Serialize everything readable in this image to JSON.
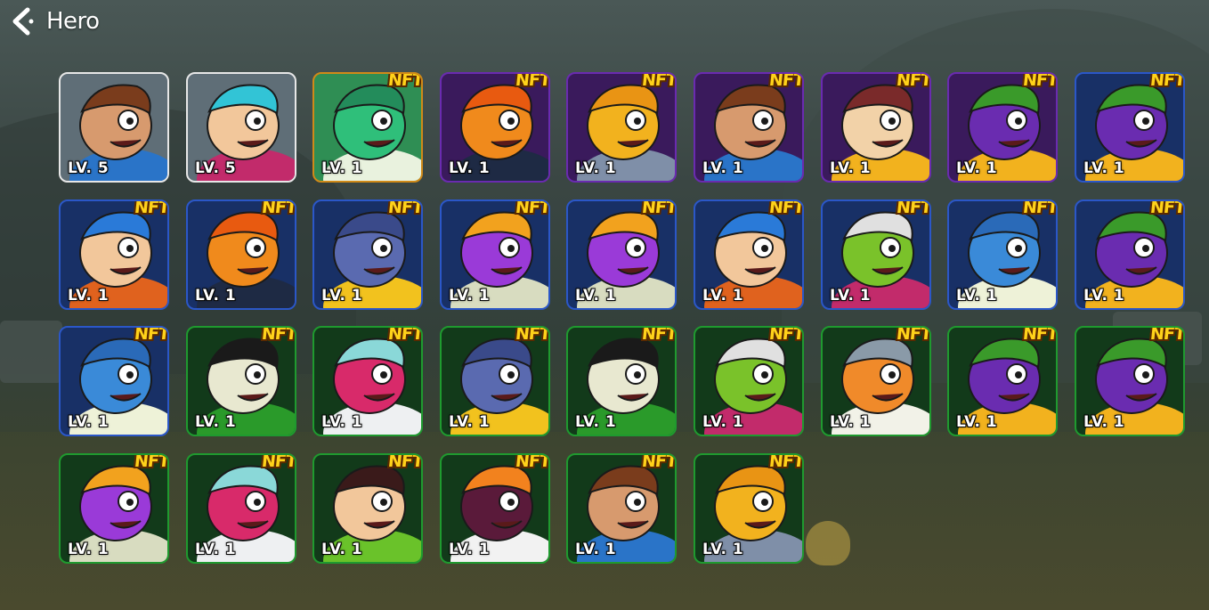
{
  "header": {
    "title": "Hero",
    "back_icon": "chevron-left-icon"
  },
  "heroes": [
    {
      "level_label": "LV. 5",
      "nft": false,
      "rarity": "white",
      "character": "caveman-blue",
      "skin": "#d79a6e",
      "accent": "#2a74c8",
      "hair": "#7a3c1c"
    },
    {
      "level_label": "LV. 5",
      "nft": false,
      "rarity": "white",
      "character": "flower-girl",
      "skin": "#f2c79b",
      "accent": "#c22b6b",
      "hair": "#32c4d6"
    },
    {
      "level_label": "LV. 1",
      "nft": true,
      "nft_label": "NFT",
      "rarity": "gold",
      "character": "green-dino",
      "skin": "#2fbf7a",
      "accent": "#e9f2de",
      "hair": "#238c5b"
    },
    {
      "level_label": "LV. 1",
      "nft": true,
      "nft_label": "NFT",
      "rarity": "purple",
      "character": "orange-bird",
      "skin": "#f08a1c",
      "accent": "#1e2a44",
      "hair": "#e85a10"
    },
    {
      "level_label": "LV. 1",
      "nft": true,
      "nft_label": "NFT",
      "rarity": "purple",
      "character": "yellow-duck",
      "skin": "#f2b21e",
      "accent": "#7f8fa8",
      "hair": "#e99414"
    },
    {
      "level_label": "LV. 1",
      "nft": true,
      "nft_label": "NFT",
      "rarity": "purple",
      "character": "caveman-blue",
      "skin": "#d79a6e",
      "accent": "#2a74c8",
      "hair": "#7a3c1c"
    },
    {
      "level_label": "LV. 1",
      "nft": true,
      "nft_label": "NFT",
      "rarity": "purple",
      "character": "monkey",
      "skin": "#f2d2a8",
      "accent": "#f2b21e",
      "hair": "#7a2a2a"
    },
    {
      "level_label": "LV. 1",
      "nft": true,
      "nft_label": "NFT",
      "rarity": "purple",
      "character": "purple-dragon",
      "skin": "#6a2cb0",
      "accent": "#f2b21e",
      "hair": "#3a9a2a"
    },
    {
      "level_label": "LV. 1",
      "nft": true,
      "nft_label": "NFT",
      "rarity": "blue",
      "character": "purple-dragon",
      "skin": "#6a2cb0",
      "accent": "#f2b21e",
      "hair": "#3a9a2a"
    },
    {
      "level_label": "LV. 1",
      "nft": true,
      "nft_label": "NFT",
      "rarity": "blue",
      "character": "blue-hair-warrior",
      "skin": "#f2c79b",
      "accent": "#e0621e",
      "hair": "#2a7ad8"
    },
    {
      "level_label": "LV. 1",
      "nft": true,
      "nft_label": "NFT",
      "rarity": "blue",
      "character": "orange-bird",
      "skin": "#f08a1c",
      "accent": "#1e2a44",
      "hair": "#e85a10"
    },
    {
      "level_label": "LV. 1",
      "nft": true,
      "nft_label": "NFT",
      "rarity": "blue",
      "character": "blue-shark-yellow",
      "skin": "#5a6ab0",
      "accent": "#f2c21e",
      "hair": "#3a4a8a"
    },
    {
      "level_label": "LV. 1",
      "nft": true,
      "nft_label": "NFT",
      "rarity": "blue",
      "character": "purple-rhino",
      "skin": "#9a3ad8",
      "accent": "#d8dcc0",
      "hair": "#f2a21e"
    },
    {
      "level_label": "LV. 1",
      "nft": true,
      "nft_label": "NFT",
      "rarity": "blue",
      "character": "purple-rhino",
      "skin": "#9a3ad8",
      "accent": "#d8dcc0",
      "hair": "#f2a21e"
    },
    {
      "level_label": "LV. 1",
      "nft": true,
      "nft_label": "NFT",
      "rarity": "blue",
      "character": "blue-hair-warrior",
      "skin": "#f2c79b",
      "accent": "#e0621e",
      "hair": "#2a7ad8"
    },
    {
      "level_label": "LV. 1",
      "nft": true,
      "nft_label": "NFT",
      "rarity": "blue",
      "character": "green-ogre",
      "skin": "#7ac22a",
      "accent": "#c22b6b",
      "hair": "#e0e0e0"
    },
    {
      "level_label": "LV. 1",
      "nft": true,
      "nft_label": "NFT",
      "rarity": "blue",
      "character": "blue-shark",
      "skin": "#3a8ad8",
      "accent": "#eef2d8",
      "hair": "#2a6ab8"
    },
    {
      "level_label": "LV. 1",
      "nft": true,
      "nft_label": "NFT",
      "rarity": "blue",
      "character": "purple-dragon",
      "skin": "#6a2cb0",
      "accent": "#f2b21e",
      "hair": "#3a9a2a"
    },
    {
      "level_label": "LV. 1",
      "nft": true,
      "nft_label": "NFT",
      "rarity": "blue",
      "character": "blue-shark",
      "skin": "#3a8ad8",
      "accent": "#eef2d8",
      "hair": "#2a6ab8"
    },
    {
      "level_label": "LV. 1",
      "nft": true,
      "nft_label": "NFT",
      "rarity": "green",
      "character": "white-cat-shades",
      "skin": "#e8e8d0",
      "accent": "#2a9a2a",
      "hair": "#1a1a1a"
    },
    {
      "level_label": "LV. 1",
      "nft": true,
      "nft_label": "NFT",
      "rarity": "green",
      "character": "pink-beast",
      "skin": "#d82a6a",
      "accent": "#eef0f2",
      "hair": "#8ad8d8"
    },
    {
      "level_label": "LV. 1",
      "nft": true,
      "nft_label": "NFT",
      "rarity": "green",
      "character": "blue-shark-yellow",
      "skin": "#5a6ab0",
      "accent": "#f2c21e",
      "hair": "#3a4a8a"
    },
    {
      "level_label": "LV. 1",
      "nft": true,
      "nft_label": "NFT",
      "rarity": "green",
      "character": "white-cat-shades",
      "skin": "#e8e8d0",
      "accent": "#2a9a2a",
      "hair": "#1a1a1a"
    },
    {
      "level_label": "LV. 1",
      "nft": true,
      "nft_label": "NFT",
      "rarity": "green",
      "character": "green-ogre",
      "skin": "#7ac22a",
      "accent": "#c22b6b",
      "hair": "#e0e0e0"
    },
    {
      "level_label": "LV. 1",
      "nft": true,
      "nft_label": "NFT",
      "rarity": "green",
      "character": "old-sage",
      "skin": "#f08a2a",
      "accent": "#f2f2e8",
      "hair": "#8a9aa8"
    },
    {
      "level_label": "LV. 1",
      "nft": true,
      "nft_label": "NFT",
      "rarity": "green",
      "character": "purple-dragon",
      "skin": "#6a2cb0",
      "accent": "#f2b21e",
      "hair": "#3a9a2a"
    },
    {
      "level_label": "LV. 1",
      "nft": true,
      "nft_label": "NFT",
      "rarity": "green",
      "character": "purple-dragon",
      "skin": "#6a2cb0",
      "accent": "#f2b21e",
      "hair": "#3a9a2a"
    },
    {
      "level_label": "LV. 1",
      "nft": true,
      "nft_label": "NFT",
      "rarity": "green",
      "character": "purple-rhino",
      "skin": "#9a3ad8",
      "accent": "#d8dcc0",
      "hair": "#f2a21e"
    },
    {
      "level_label": "LV. 1",
      "nft": true,
      "nft_label": "NFT",
      "rarity": "green",
      "character": "pink-beast",
      "skin": "#d82a6a",
      "accent": "#eef0f2",
      "hair": "#8ad8d8"
    },
    {
      "level_label": "LV. 1",
      "nft": true,
      "nft_label": "NFT",
      "rarity": "green",
      "character": "leaf-caveman",
      "skin": "#f2c79b",
      "accent": "#6ac22a",
      "hair": "#3a1a1a"
    },
    {
      "level_label": "LV. 1",
      "nft": true,
      "nft_label": "NFT",
      "rarity": "green",
      "character": "grin-monster",
      "skin": "#5a1a3a",
      "accent": "#f2f2f2",
      "hair": "#f2821e"
    },
    {
      "level_label": "LV. 1",
      "nft": true,
      "nft_label": "NFT",
      "rarity": "green",
      "character": "caveman-blue",
      "skin": "#d79a6e",
      "accent": "#2a74c8",
      "hair": "#7a3c1c"
    },
    {
      "level_label": "LV. 1",
      "nft": true,
      "nft_label": "NFT",
      "rarity": "green",
      "character": "yellow-duck",
      "skin": "#f2b21e",
      "accent": "#7f8fa8",
      "hair": "#e99414"
    }
  ]
}
